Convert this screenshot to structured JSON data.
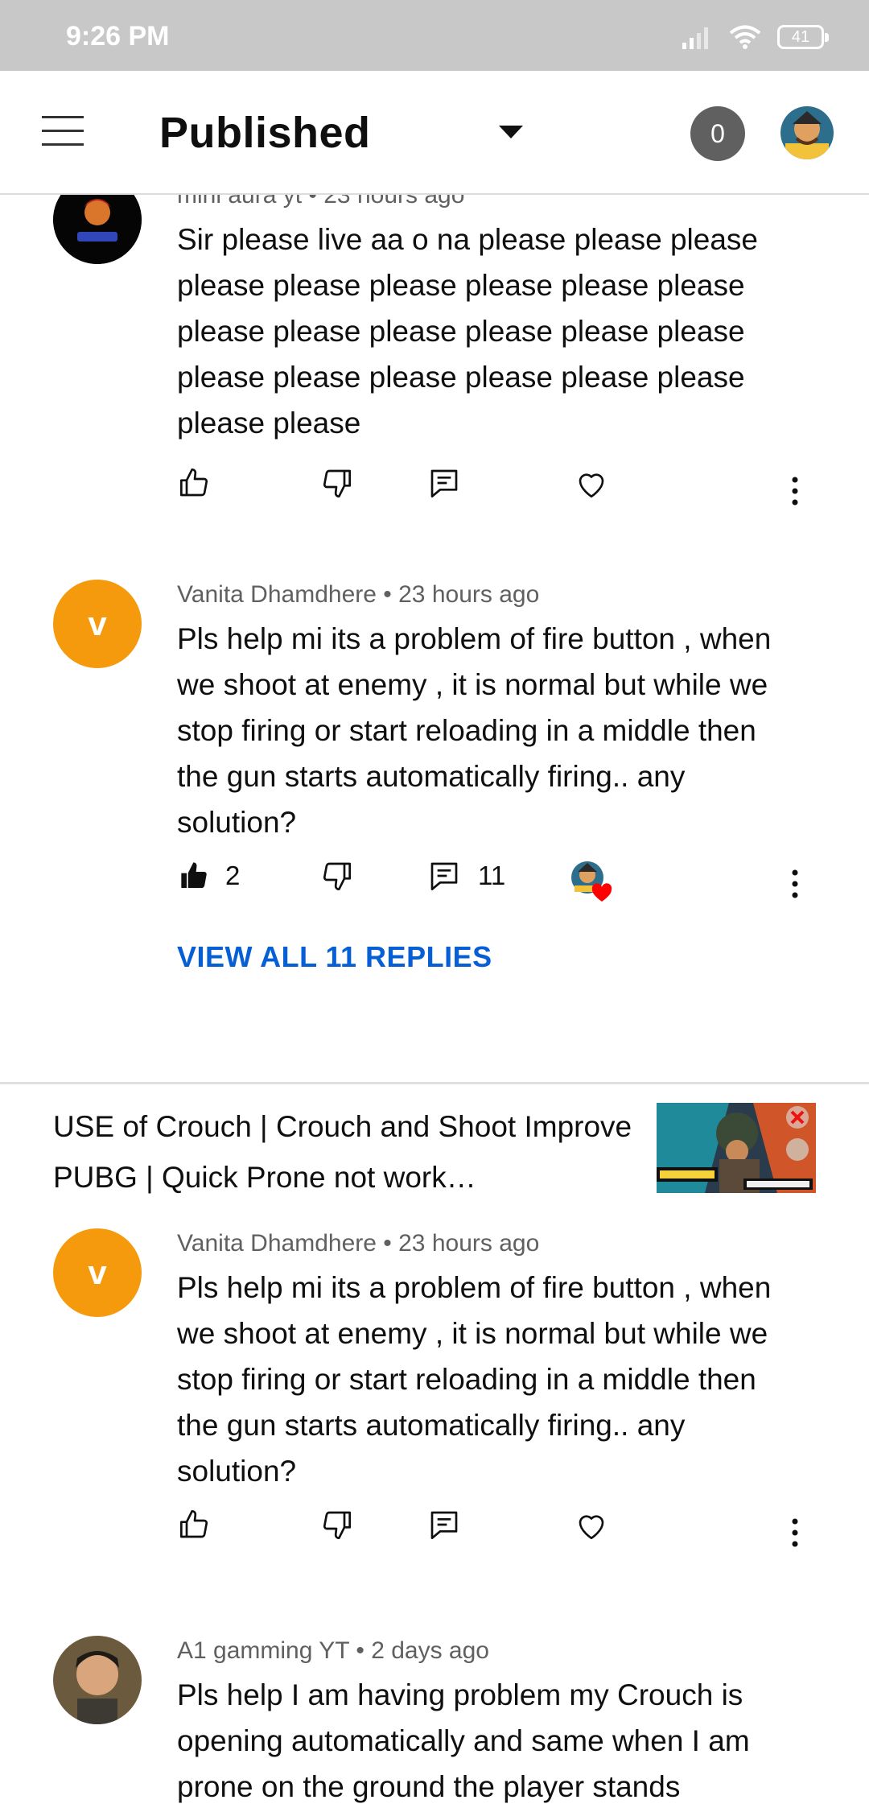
{
  "status_bar": {
    "time": "9:26 PM",
    "battery": "41",
    "icons": [
      "signal-icon",
      "wifi-icon",
      "battery-icon"
    ]
  },
  "header": {
    "menu_icon": "hamburger-icon",
    "title": "Published",
    "dropdown_icon": "caret-down-icon",
    "notifications_count": "0"
  },
  "comments": [
    {
      "author": "mini aura yt",
      "time": "23 hours ago",
      "text": "Sir please live aa o na please please please please please please please please please please please please please please please please please please please please please please please",
      "likes": "",
      "replies": "",
      "hearted": false
    },
    {
      "author": "Vanita Dhamdhere",
      "time": "23 hours ago",
      "avatar_letter": "v",
      "text": "Pls help mi its a problem of fire button , when we shoot at enemy , it is normal but while we stop firing or start reloading in a middle then the gun starts automatically firing.. any solution?",
      "likes": "2",
      "replies": "11",
      "hearted": true,
      "view_replies": "VIEW ALL 11 REPLIES"
    }
  ],
  "video": {
    "title": "USE of Crouch | Crouch and Shoot Improve PUBG | Quick Prone not work…"
  },
  "video_comments": [
    {
      "author": "Vanita Dhamdhere",
      "time": "23 hours ago",
      "avatar_letter": "v",
      "text": "Pls help mi its a problem of fire button , when we shoot at enemy , it is normal but while we stop firing or start reloading in a middle then the gun starts automatically firing.. any solution?"
    },
    {
      "author": "A1 gamming YT",
      "time": "2 days ago",
      "text": "Pls help I am having problem my Crouch is opening automatically and same when I am prone on the ground the player stands"
    }
  ],
  "colors": {
    "accent_link": "#065fd4",
    "avatar_orange": "#f59a0c",
    "heart_red": "#ff0000",
    "status_bar": "#c8c8c8"
  }
}
